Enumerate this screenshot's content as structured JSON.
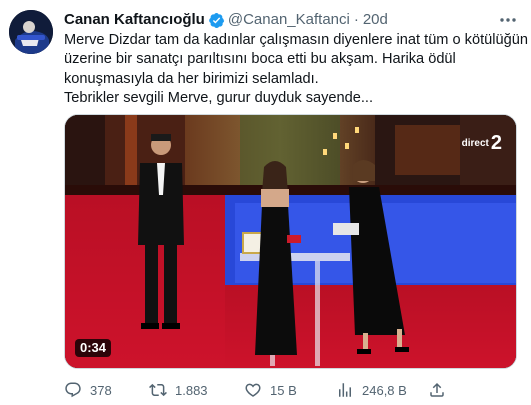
{
  "tweet": {
    "author_name": "Canan Kaftancıoğlu",
    "handle": "@Canan_Kaftanci",
    "separator": "·",
    "time": "20d",
    "text_lines": [
      "Merve Dizdar tam da kadınlar çalışmasın diyenlere inat tüm o kötülüğün",
      "üzerine bir sanatçı parıltısını boca etti bu akşam. Harika ödül",
      "konuşmasıyla da her birimizi selamladı.",
      "Tebrikler sevgili Merve, gurur duyduk sayende..."
    ]
  },
  "media": {
    "duration": "0:34",
    "channel_label": "direct",
    "channel_number": "2"
  },
  "actions": {
    "replies": "378",
    "retweets": "1.883",
    "likes": "15 B",
    "views": "246,8 B"
  },
  "colors": {
    "text_primary": "#0f1419",
    "text_secondary": "#536471",
    "verified_blue": "#1d9bf0",
    "stage_red": "#c8102e"
  },
  "icons": [
    "verified-badge-icon",
    "more-options-icon",
    "reply-icon",
    "retweet-icon",
    "like-icon",
    "views-icon",
    "share-icon"
  ]
}
